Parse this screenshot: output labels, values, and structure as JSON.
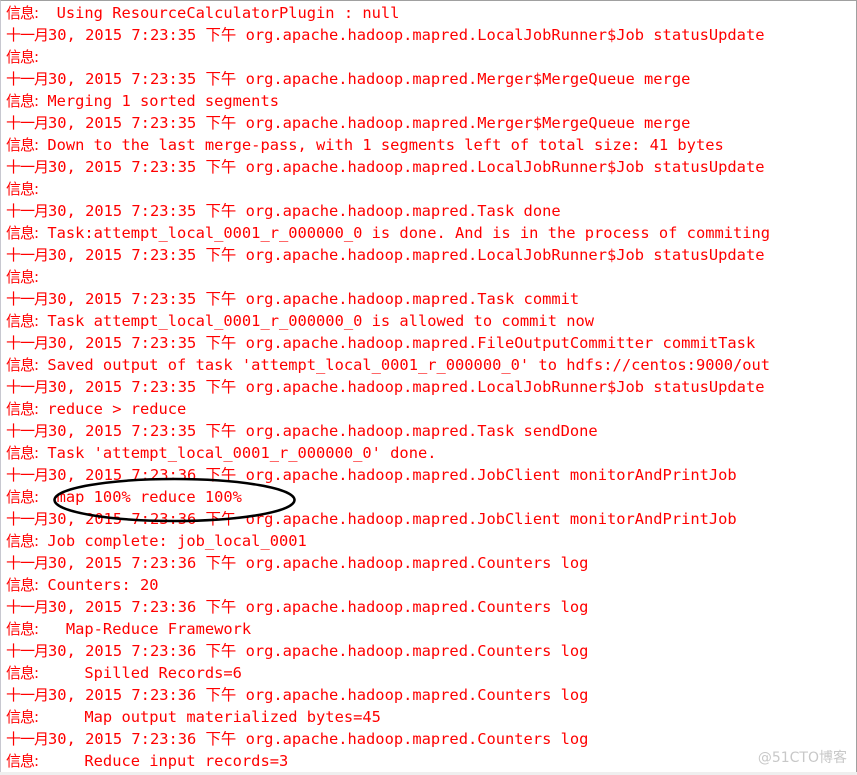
{
  "console": {
    "text_color": "#ff0000",
    "lines": [
      {
        "prefix": "信息:",
        "text": "  Using ResourceCalculatorPlugin : null"
      },
      {
        "prefix": "十一月",
        "text": "30, 2015 7:23:35 下午 org.apache.hadoop.mapred.LocalJobRunner$Job statusUpdate"
      },
      {
        "prefix": "信息:",
        "text": ""
      },
      {
        "prefix": "十一月",
        "text": "30, 2015 7:23:35 下午 org.apache.hadoop.mapred.Merger$MergeQueue merge"
      },
      {
        "prefix": "信息:",
        "text": " Merging 1 sorted segments"
      },
      {
        "prefix": "十一月",
        "text": "30, 2015 7:23:35 下午 org.apache.hadoop.mapred.Merger$MergeQueue merge"
      },
      {
        "prefix": "信息:",
        "text": " Down to the last merge-pass, with 1 segments left of total size: 41 bytes"
      },
      {
        "prefix": "十一月",
        "text": "30, 2015 7:23:35 下午 org.apache.hadoop.mapred.LocalJobRunner$Job statusUpdate"
      },
      {
        "prefix": "信息:",
        "text": ""
      },
      {
        "prefix": "十一月",
        "text": "30, 2015 7:23:35 下午 org.apache.hadoop.mapred.Task done"
      },
      {
        "prefix": "信息:",
        "text": " Task:attempt_local_0001_r_000000_0 is done. And is in the process of commiting"
      },
      {
        "prefix": "十一月",
        "text": "30, 2015 7:23:35 下午 org.apache.hadoop.mapred.LocalJobRunner$Job statusUpdate"
      },
      {
        "prefix": "信息:",
        "text": ""
      },
      {
        "prefix": "十一月",
        "text": "30, 2015 7:23:35 下午 org.apache.hadoop.mapred.Task commit"
      },
      {
        "prefix": "信息:",
        "text": " Task attempt_local_0001_r_000000_0 is allowed to commit now"
      },
      {
        "prefix": "十一月",
        "text": "30, 2015 7:23:35 下午 org.apache.hadoop.mapred.FileOutputCommitter commitTask"
      },
      {
        "prefix": "信息:",
        "text": " Saved output of task 'attempt_local_0001_r_000000_0' to hdfs://centos:9000/out"
      },
      {
        "prefix": "十一月",
        "text": "30, 2015 7:23:35 下午 org.apache.hadoop.mapred.LocalJobRunner$Job statusUpdate"
      },
      {
        "prefix": "信息:",
        "text": " reduce > reduce"
      },
      {
        "prefix": "十一月",
        "text": "30, 2015 7:23:35 下午 org.apache.hadoop.mapred.Task sendDone"
      },
      {
        "prefix": "信息:",
        "text": " Task 'attempt_local_0001_r_000000_0' done."
      },
      {
        "prefix": "十一月",
        "text": "30, 2015 7:23:36 下午 org.apache.hadoop.mapred.JobClient monitorAndPrintJob"
      },
      {
        "prefix": "信息:",
        "text": "  map 100% reduce 100%"
      },
      {
        "prefix": "十一月",
        "text": "30, 2015 7:23:36 下午 org.apache.hadoop.mapred.JobClient monitorAndPrintJob"
      },
      {
        "prefix": "信息:",
        "text": " Job complete: job_local_0001"
      },
      {
        "prefix": "十一月",
        "text": "30, 2015 7:23:36 下午 org.apache.hadoop.mapred.Counters log"
      },
      {
        "prefix": "信息:",
        "text": " Counters: 20"
      },
      {
        "prefix": "十一月",
        "text": "30, 2015 7:23:36 下午 org.apache.hadoop.mapred.Counters log"
      },
      {
        "prefix": "信息:",
        "text": "   Map-Reduce Framework"
      },
      {
        "prefix": "十一月",
        "text": "30, 2015 7:23:36 下午 org.apache.hadoop.mapred.Counters log"
      },
      {
        "prefix": "信息:",
        "text": "     Spilled Records=6"
      },
      {
        "prefix": "十一月",
        "text": "30, 2015 7:23:36 下午 org.apache.hadoop.mapred.Counters log"
      },
      {
        "prefix": "信息:",
        "text": "     Map output materialized bytes=45"
      },
      {
        "prefix": "十一月",
        "text": "30, 2015 7:23:36 下午 org.apache.hadoop.mapred.Counters log"
      },
      {
        "prefix": "信息:",
        "text": "     Reduce input records=3"
      }
    ]
  },
  "annotation": {
    "highlighted_text": "map 100% reduce 100%",
    "stroke_color": "#000000"
  },
  "watermark": "@51CTO博客"
}
